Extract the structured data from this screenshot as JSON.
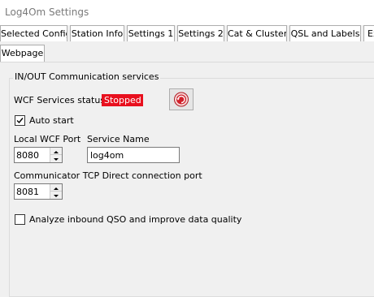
{
  "window": {
    "title": "Log4Om Settings"
  },
  "tabs": {
    "row1": [
      "Selected Config",
      "Station Info",
      "Settings 1",
      "Settings 2",
      "Cat & Cluster",
      "QSL and Labels",
      "Ex"
    ],
    "row2": [
      "Webpage"
    ]
  },
  "group": {
    "legend": "IN/OUT Communication services",
    "wcf_status_label": "WCF Services status",
    "wcf_status_value": "Stopped",
    "auto_start_label": "Auto start",
    "auto_start_checked": true,
    "local_wcf_port_label": "Local WCF Port",
    "local_wcf_port_value": "8080",
    "service_name_label": "Service Name",
    "service_name_value": "log4om",
    "tcp_port_label": "Communicator TCP Direct connection port",
    "tcp_port_value": "8081",
    "analyze_label": "Analyze inbound QSO and improve data quality",
    "analyze_checked": false
  },
  "colors": {
    "status_stopped": "#e8101e",
    "refresh_icon": "#d0202a"
  },
  "icons": {
    "refresh": "refresh-icon",
    "check": "check-icon"
  }
}
